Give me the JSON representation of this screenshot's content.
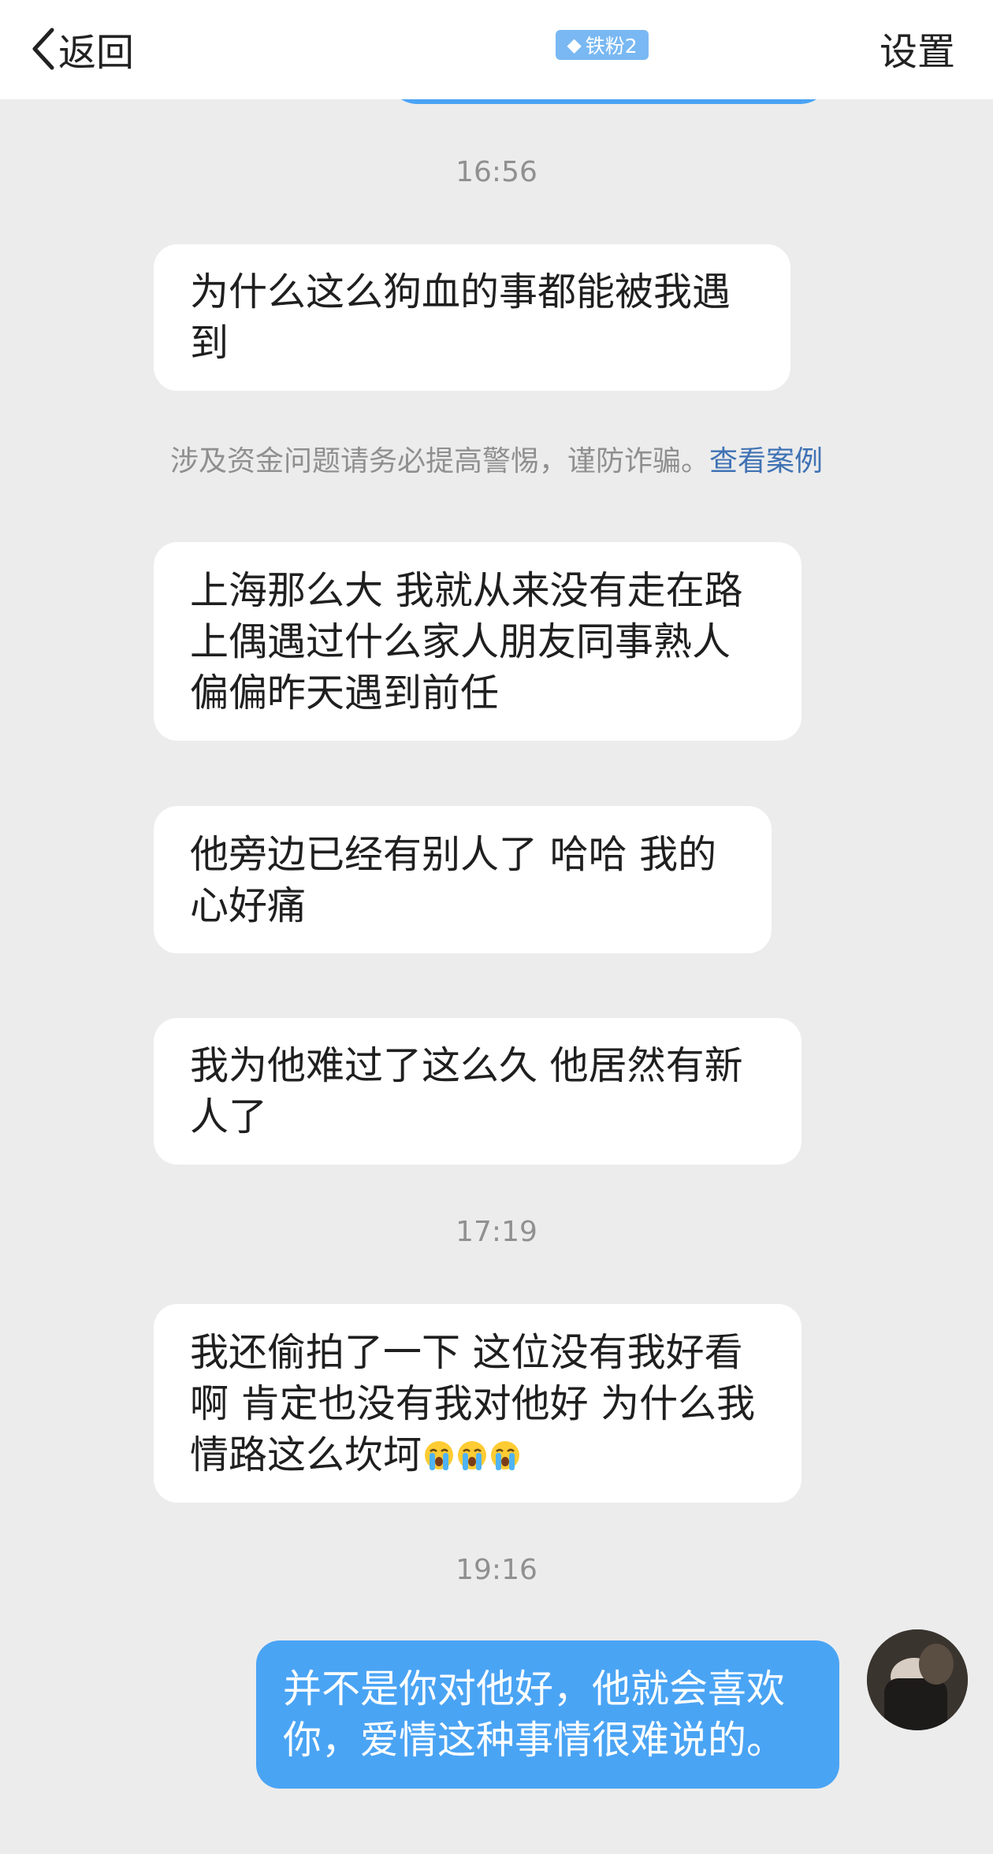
{
  "header": {
    "back_label": "返回",
    "badge_label": "铁粉2",
    "settings_label": "设置"
  },
  "notice": {
    "text": "涉及资金问题请务必提高警惕，谨防诈骗。",
    "link": "查看案例"
  },
  "timestamps": [
    "16:56",
    "17:19",
    "19:16"
  ],
  "messages": [
    {
      "text": "为什么这么狗血的事都能被我遇到"
    },
    {
      "text": "上海那么大 我就从来没有走在路上偶遇过什么家人朋友同事熟人偏偏昨天遇到前任"
    },
    {
      "text": "他旁边已经有别人了 哈哈 我的心好痛"
    },
    {
      "text": "我为他难过了这么久 他居然有新人了"
    },
    {
      "text": "我还偷拍了一下 这位没有我好看啊 肯定也没有我对他好 为什么我情路这么坎坷",
      "emoji": "loudly-crying-face ×3"
    },
    {
      "text": "并不是你对他好，他就会喜欢你，爱情这种事情很难说的。",
      "mine": true
    }
  ],
  "colors": {
    "background": "#ececec",
    "incoming_bubble": "#ffffff",
    "outgoing_bubble": "#4aa4f4",
    "link": "#3f72b4",
    "badge": "#79b8f2"
  }
}
